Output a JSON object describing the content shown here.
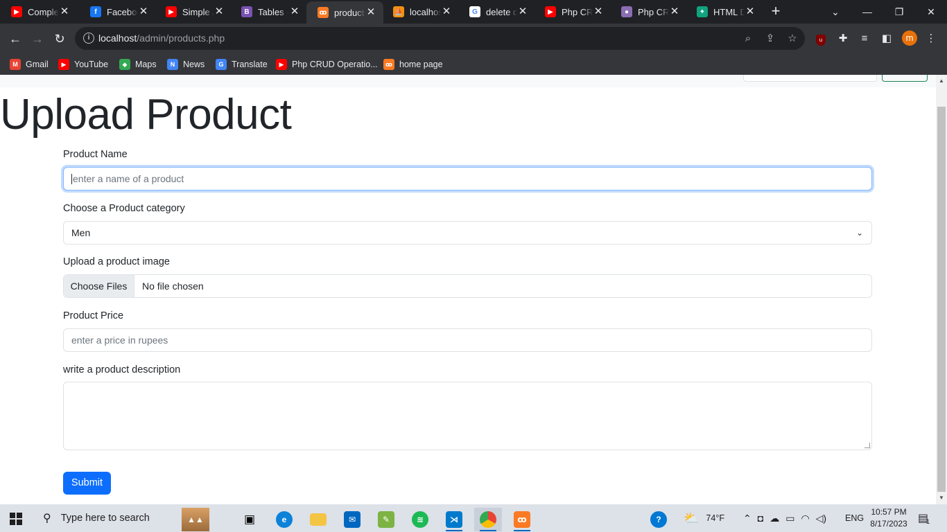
{
  "browser": {
    "tabs": [
      {
        "title": "Complete",
        "icon": "youtube-icon",
        "color": "#ff0000",
        "glyph": "▶"
      },
      {
        "title": "Facebook",
        "icon": "facebook-icon",
        "color": "#1877f2",
        "glyph": "f"
      },
      {
        "title": "Simple A",
        "icon": "youtube-icon",
        "color": "#ff0000",
        "glyph": "▶"
      },
      {
        "title": "Tables · B",
        "icon": "bootstrap-icon",
        "color": "#7952b3",
        "glyph": "B"
      },
      {
        "title": "products",
        "icon": "xampp-icon",
        "color": "#fb7a24",
        "glyph": "ꝏ"
      },
      {
        "title": "localhost",
        "icon": "phpmyadmin-icon",
        "color": "#f29111",
        "glyph": "⛵"
      },
      {
        "title": "delete d",
        "icon": "google-icon",
        "color": "#ffffff",
        "glyph": "G"
      },
      {
        "title": "Php CRU",
        "icon": "youtube-icon",
        "color": "#ff0000",
        "glyph": "▶"
      },
      {
        "title": "Php CRU",
        "icon": "avatar-icon",
        "color": "#8a6db3",
        "glyph": "●"
      },
      {
        "title": "HTML D",
        "icon": "chatgpt-icon",
        "color": "#10a37f",
        "glyph": "✦"
      }
    ],
    "url_host": "localhost",
    "url_path": "/admin/products.php",
    "profile_initial": "m",
    "bookmarks": [
      {
        "label": "Gmail",
        "icon": "gmail-icon",
        "color": "#ea4335",
        "glyph": "M"
      },
      {
        "label": "YouTube",
        "icon": "youtube-icon",
        "color": "#ff0000",
        "glyph": "▶"
      },
      {
        "label": "Maps",
        "icon": "maps-icon",
        "color": "#34a853",
        "glyph": "◆"
      },
      {
        "label": "News",
        "icon": "news-icon",
        "color": "#4285f4",
        "glyph": "N"
      },
      {
        "label": "Translate",
        "icon": "translate-icon",
        "color": "#4285f4",
        "glyph": "G"
      },
      {
        "label": "Php CRUD Operatio...",
        "icon": "youtube-icon",
        "color": "#ff0000",
        "glyph": "▶"
      },
      {
        "label": "home page",
        "icon": "xampp-icon",
        "color": "#fb7a24",
        "glyph": "ꝏ"
      }
    ]
  },
  "page": {
    "title": "Upload Product",
    "product_name": {
      "label": "Product Name",
      "placeholder": "enter a name of a product"
    },
    "category": {
      "label": "Choose a Product category",
      "value": "Men"
    },
    "image": {
      "label": "Upload a product image",
      "button": "Choose Files",
      "status": "No file chosen"
    },
    "price": {
      "label": "Product Price",
      "placeholder": "enter a price in rupees"
    },
    "description": {
      "label": "write a product description",
      "value": ""
    },
    "submit": "Submit"
  },
  "taskbar": {
    "search_placeholder": "Type here to search",
    "weather": "74°F",
    "language": "ENG",
    "time": "10:57 PM",
    "date": "8/17/2023",
    "notification_count": "1"
  }
}
